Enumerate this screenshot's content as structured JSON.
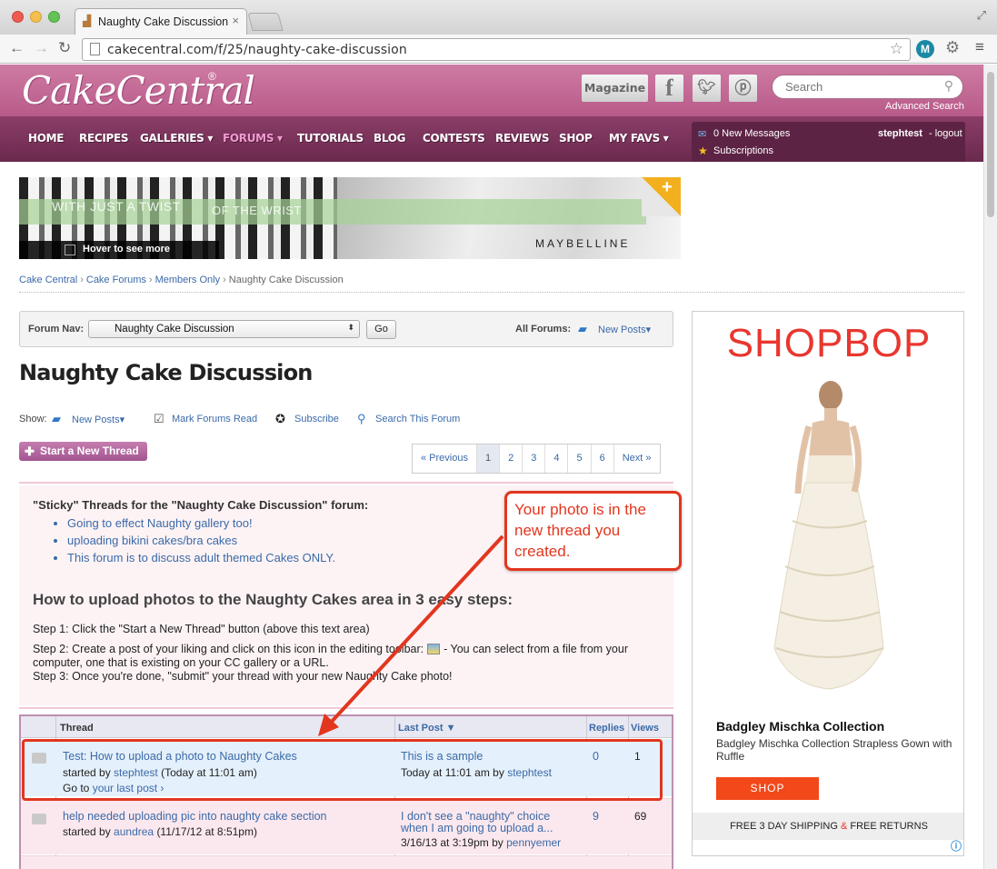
{
  "browser": {
    "tab_title": "Naughty Cake Discussion",
    "url": "cakecentral.com/f/25/naughty-cake-discussion",
    "extension_label": "M"
  },
  "site": {
    "logo": "CakeCentral",
    "logo_mark": "®",
    "magazine_label": "Magazine",
    "facebook_label": "f",
    "search_placeholder": "Search",
    "advanced_search": "Advanced Search"
  },
  "nav": {
    "items": [
      {
        "label": "HOME"
      },
      {
        "label": "RECIPES"
      },
      {
        "label": "GALLERIES ▾"
      },
      {
        "label": "FORUMS ▾"
      },
      {
        "label": "TUTORIALS"
      },
      {
        "label": "BLOG"
      },
      {
        "label": "CONTESTS"
      },
      {
        "label": "REVIEWS"
      },
      {
        "label": "SHOP"
      },
      {
        "label": "MY FAVS ▾"
      }
    ],
    "messages": "0 New Messages",
    "subscriptions": "Subscriptions",
    "username": "stephtest",
    "logout": "- logout"
  },
  "banner": {
    "line1": "WITH JUST A TWIST",
    "line2": "OF THE WRIST",
    "hover": "Hover to see more",
    "brand": "MAYBELLINE",
    "corner_mark": "+"
  },
  "breadcrumb": [
    "Cake Central",
    "Cake Forums",
    "Members Only",
    "Naughty Cake Discussion"
  ],
  "forum_nav": {
    "label": "Forum Nav:",
    "selected": "Naughty Cake Discussion",
    "go": "Go",
    "all_forums": "All Forums:",
    "new_posts": "New Posts"
  },
  "page_title": "Naughty Cake Discussion",
  "tools": {
    "show": "Show:",
    "new_posts": "New Posts",
    "mark_read": "Mark Forums Read",
    "subscribe": "Subscribe",
    "search_forum": "Search This Forum"
  },
  "new_thread": "Start a New Thread",
  "pager": [
    "« Previous",
    "1",
    "2",
    "3",
    "4",
    "5",
    "6",
    "Next »"
  ],
  "sticky": {
    "heading": "\"Sticky\" Threads for the \"Naughty Cake Discussion\" forum:",
    "items": [
      "Going to effect Naughty gallery too!",
      "uploading bikini cakes/bra cakes",
      "This forum is to discuss adult themed Cakes ONLY."
    ],
    "howto_title": "How to upload photos to the Naughty Cakes area in 3 easy steps:",
    "step1": "Step 1: Click the \"Start a New Thread\" button (above this text area)",
    "step2a": "Step 2: Create a post of your liking and click on this icon in the editing toolbar:",
    "step2b": "- You can select from a file from your computer, one that is existing on your CC gallery or a URL.",
    "step3": "Step 3: Once you're done, \"submit\" your thread with your new Naughty Cake photo!"
  },
  "table": {
    "headers": {
      "thread": "Thread",
      "last_post": "Last Post ▼",
      "replies": "Replies",
      "views": "Views"
    },
    "rows": [
      {
        "title": "Test: How to upload a photo to Naughty Cakes",
        "started_by_prefix": "started by",
        "author": "stephtest",
        "date": "(Today at 11:01 am)",
        "goto_prefix": "Go to",
        "goto_link": "your last post ›",
        "last_title": "This is a sample",
        "last_date": "Today at 11:01 am by",
        "last_author": "stephtest",
        "replies": "0",
        "views": "1"
      },
      {
        "title": "help needed uploading pic into naughty cake section",
        "started_by_prefix": "started by",
        "author": "aundrea",
        "date": "(11/17/12 at 8:51pm)",
        "last_title_line1": "I don't see a \"naughty\" choice",
        "last_title_line2": "when I am going to upload a...",
        "last_date": "3/16/13 at 3:19pm by",
        "last_author": "pennyemer",
        "replies": "9",
        "views": "69"
      }
    ]
  },
  "callout": "Your photo is in the new thread you created.",
  "side_ad": {
    "brand": "SHOPBOP",
    "title": "Badgley Mischka Collection",
    "subtitle": "Badgley Mischka Collection Strapless Gown with Ruffle",
    "button": "SHOP",
    "footer_a": "FREE 3 DAY SHIPPING",
    "footer_amp": "&",
    "footer_b": "FREE RETURNS"
  },
  "colors": {
    "header_pink": "#b85a89",
    "nav_purple": "#6b2a4e",
    "link_blue": "#3b6aa8",
    "callout_red": "#e2361f",
    "shopbop_red": "#e8372f"
  }
}
